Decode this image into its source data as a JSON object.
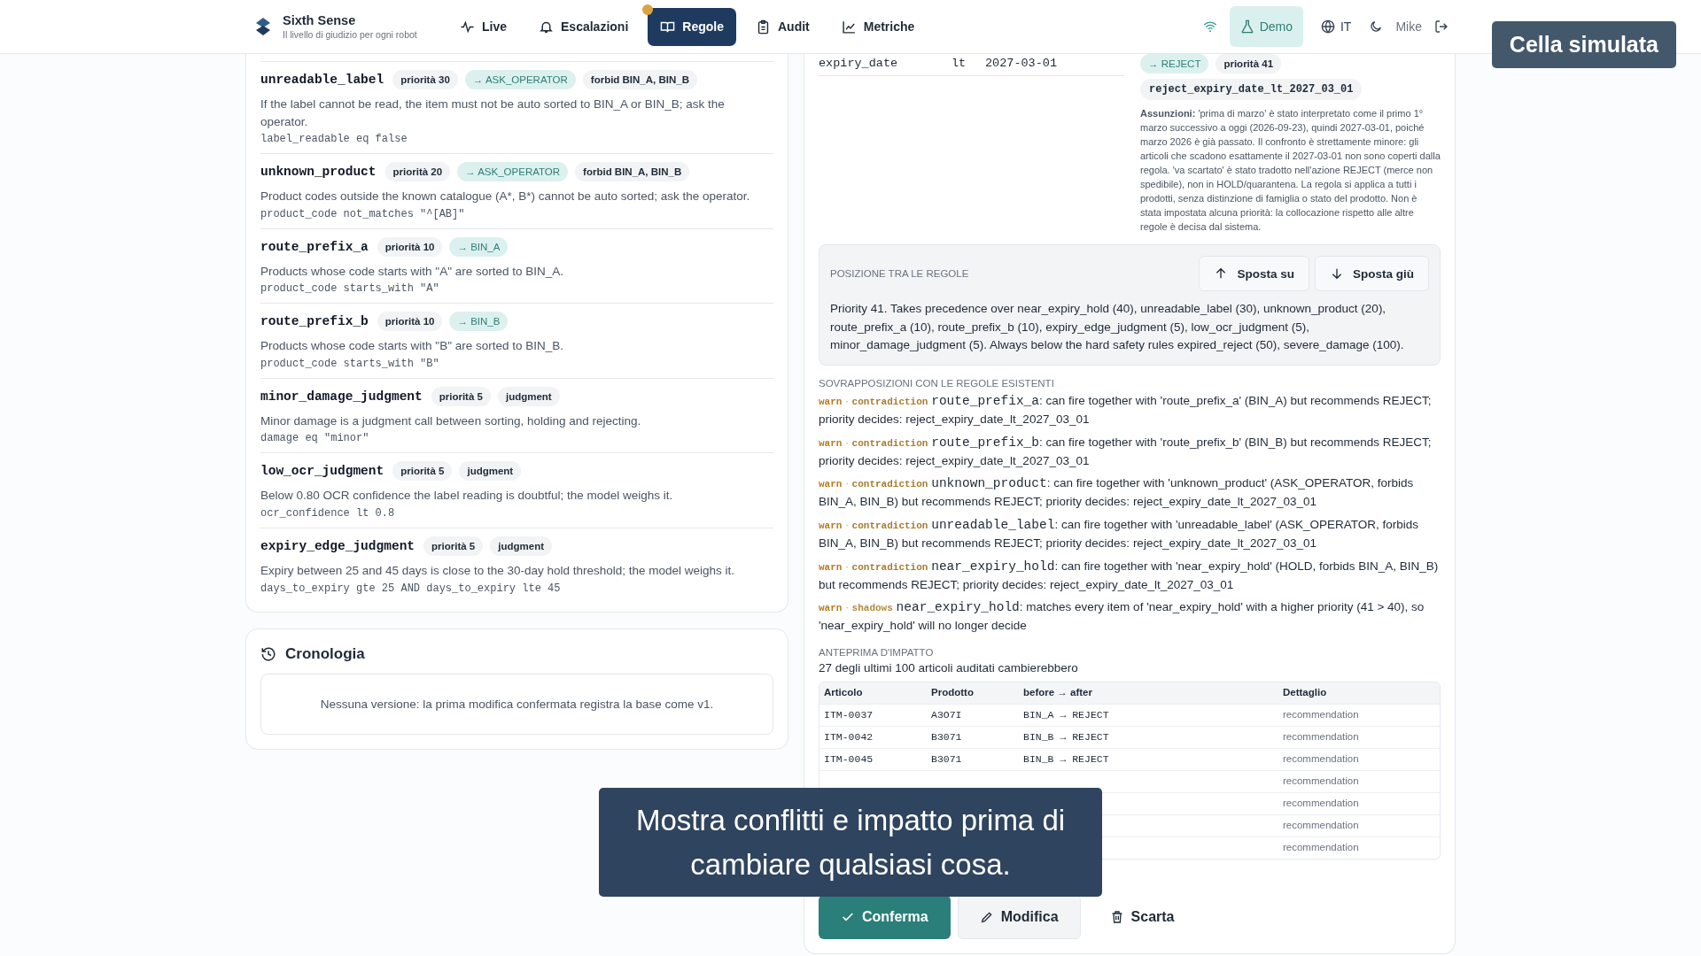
{
  "header": {
    "brand": {
      "name": "Sixth Sense",
      "tagline": "Il livello di giudizio per ogni robot"
    },
    "nav": [
      {
        "label": "Live",
        "selected": false,
        "badge": false
      },
      {
        "label": "Escalazioni",
        "selected": false,
        "badge": false
      },
      {
        "label": "Regole",
        "selected": true,
        "badge": true
      },
      {
        "label": "Audit",
        "selected": false,
        "badge": false
      },
      {
        "label": "Metriche",
        "selected": false,
        "badge": false
      }
    ],
    "demo": {
      "label": "Demo",
      "on": true
    },
    "language": "IT",
    "user": "Mike"
  },
  "rules": [
    {
      "name": "unreadable_label",
      "priority": "priorità 30",
      "tags": [
        {
          "kind": "action",
          "text": "→ ASK_OPERATOR"
        },
        {
          "kind": "plain",
          "text": "forbid BIN_A, BIN_B"
        }
      ],
      "description": "If the label cannot be read, the item must not be auto sorted to BIN_A or BIN_B; ask the operator.",
      "condition": "label_readable eq false"
    },
    {
      "name": "unknown_product",
      "priority": "priorità 20",
      "tags": [
        {
          "kind": "action",
          "text": "→ ASK_OPERATOR"
        },
        {
          "kind": "plain",
          "text": "forbid BIN_A, BIN_B"
        }
      ],
      "description": "Product codes outside the known catalogue (A*, B*) cannot be auto sorted; ask the operator.",
      "condition": "product_code not_matches \"^[AB]\""
    },
    {
      "name": "route_prefix_a",
      "priority": "priorità 10",
      "tags": [
        {
          "kind": "action",
          "text": "→ BIN_A"
        }
      ],
      "description": "Products whose code starts with \"A\" are sorted to BIN_A.",
      "condition": "product_code starts_with \"A\""
    },
    {
      "name": "route_prefix_b",
      "priority": "priorità 10",
      "tags": [
        {
          "kind": "action",
          "text": "→ BIN_B"
        }
      ],
      "description": "Products whose code starts with \"B\" are sorted to BIN_B.",
      "condition": "product_code starts_with \"B\""
    },
    {
      "name": "minor_damage_judgment",
      "priority": "priorità 5",
      "tags": [
        {
          "kind": "plain",
          "text": "judgment"
        }
      ],
      "description": "Minor damage is a judgment call between sorting, holding and rejecting.",
      "condition": "damage eq \"minor\""
    },
    {
      "name": "low_ocr_judgment",
      "priority": "priorità 5",
      "tags": [
        {
          "kind": "plain",
          "text": "judgment"
        }
      ],
      "description": "Below 0.80 OCR confidence the label reading is doubtful; the model weighs it.",
      "condition": "ocr_confidence lt 0.8"
    },
    {
      "name": "expiry_edge_judgment",
      "priority": "priorità 5",
      "tags": [
        {
          "kind": "plain",
          "text": "judgment"
        }
      ],
      "description": "Expiry between 25 and 45 days is close to the 30-day hold threshold; the model weighs it.",
      "condition": "days_to_expiry gte 25 AND days_to_expiry lte 45"
    }
  ],
  "history": {
    "title": "Cronologia",
    "empty": "Nessuna versione: la prima modifica confermata registra la base come v1."
  },
  "proposal": {
    "conditions": [
      {
        "field": "expiry_date",
        "op": "lt",
        "value": "2027-03-01"
      }
    ],
    "tags": [
      {
        "kind": "action",
        "text": "→ REJECT"
      },
      {
        "kind": "plain",
        "text": "priorità 41"
      }
    ],
    "rule_id": "reject_expiry_date_lt_2027_03_01",
    "assumptions": "**Assunzioni:** 'prima di marzo' è stato interpretato come il primo 1° marzo successivo a oggi (2026-09-23), quindi 2027-03-01, poiché marzo 2026 è già passato. Il confronto è strettamente minore: gli articoli che scadono esattamente il 2027-03-01 non sono coperti dalla regola. 'va scartato' è stato tradotto nell'azione REJECT (merce non spedibile), non in HOLD/quarantena. La regola si applica a tutti i prodotti, senza distinzione di famiglia o stato del prodotto. Non è stata impostata alcuna priorità: la collocazione rispetto alle altre regole è decisa dal sistema."
  },
  "position": {
    "heading": "POSIZIONE TRA LE REGOLE",
    "buttons": [
      {
        "label": "Sposta su",
        "kind": "up"
      },
      {
        "label": "Sposta giù",
        "kind": "down"
      }
    ],
    "text": "Priority 41. Takes precedence over near_expiry_hold (40), unreadable_label (30), unknown_product (20), route_prefix_a (10), route_prefix_b (10), expiry_edge_judgment (5), low_ocr_judgment (5), minor_damage_judgment (5). Always below the hard safety rules expired_reject (50), severe_damage (100)."
  },
  "overlaps": {
    "heading": "SOVRAPPOSIZIONI CON LE REGOLE ESISTENTI",
    "items": [
      {
        "level": "warn",
        "separator": "·",
        "kind": "contradiction",
        "rule": "route_prefix_a",
        "message": ": can fire together with 'route_prefix_a' (BIN_A) but recommends REJECT; priority decides: reject_expiry_date_lt_2027_03_01"
      },
      {
        "level": "warn",
        "separator": "·",
        "kind": "contradiction",
        "rule": "route_prefix_b",
        "message": ": can fire together with 'route_prefix_b' (BIN_B) but recommends REJECT; priority decides: reject_expiry_date_lt_2027_03_01"
      },
      {
        "level": "warn",
        "separator": "·",
        "kind": "contradiction",
        "rule": "unknown_product",
        "message": ": can fire together with 'unknown_product' (ASK_OPERATOR, forbids BIN_A, BIN_B) but recommends REJECT; priority decides: reject_expiry_date_lt_2027_03_01"
      },
      {
        "level": "warn",
        "separator": "·",
        "kind": "contradiction",
        "rule": "unreadable_label",
        "message": ": can fire together with 'unreadable_label' (ASK_OPERATOR, forbids BIN_A, BIN_B) but recommends REJECT; priority decides: reject_expiry_date_lt_2027_03_01"
      },
      {
        "level": "warn",
        "separator": "·",
        "kind": "contradiction",
        "rule": "near_expiry_hold",
        "message": ": can fire together with 'near_expiry_hold' (HOLD, forbids BIN_A, BIN_B) but recommends REJECT; priority decides: reject_expiry_date_lt_2027_03_01"
      },
      {
        "level": "warn",
        "separator": "·",
        "kind": "shadows",
        "rule": "near_expiry_hold",
        "message": ": matches every item of 'near_expiry_hold' with a higher priority (41 > 40), so 'near_expiry_hold' will no longer decide"
      }
    ]
  },
  "impact": {
    "heading": "ANTEPRIMA D'IMPATTO",
    "summary": "27 degli ultimi 100 articoli auditati cambierebbero",
    "columns": [
      "Articolo",
      "Prodotto",
      "before → after",
      "Dettaglio"
    ],
    "rows": [
      {
        "article": "ITM-0037",
        "product": "A3O7I",
        "change": "BIN_A → REJECT",
        "detail": "recommendation"
      },
      {
        "article": "ITM-0042",
        "product": "B3071",
        "change": "BIN_B → REJECT",
        "detail": "recommendation"
      },
      {
        "article": "ITM-0045",
        "product": "B3071",
        "change": "BIN_B → REJECT",
        "detail": "recommendation"
      },
      {
        "detail": "recommendation"
      },
      {
        "detail": "recommendation"
      },
      {
        "detail": "recommendation"
      },
      {
        "detail": "recommendation"
      }
    ]
  },
  "actions": [
    {
      "label": "Conferma",
      "kind": "primary"
    },
    {
      "label": "Modifica",
      "kind": "secondary"
    },
    {
      "label": "Scarta",
      "kind": "ghost"
    }
  ],
  "overlays": {
    "badge": "Cella simulata",
    "caption": "Mostra conflitti e impatto prima di cambiare qualsiasi cosa."
  }
}
